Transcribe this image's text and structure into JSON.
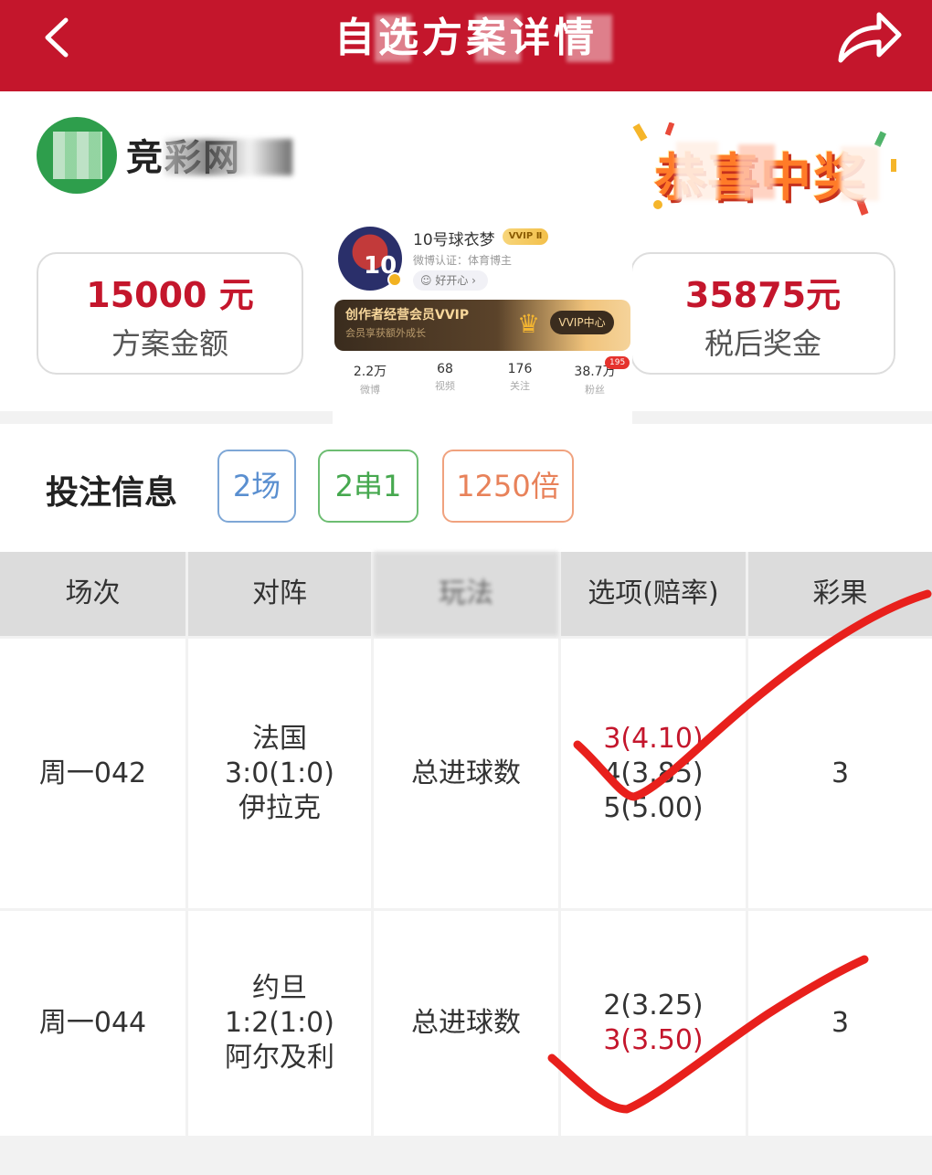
{
  "header": {
    "title": "自选方案详情",
    "back_icon": "chevron-left-icon",
    "share_icon": "share-icon",
    "bg_color": "#c4162c"
  },
  "brand": {
    "logo_icon": "lottery-logo-icon",
    "name": "竞彩网",
    "badge": "恭喜中奖"
  },
  "summary": {
    "plan_amount": "15000 元",
    "plan_amount_label": "方案金额",
    "prize_amount": "35875元",
    "prize_amount_label": "税后奖金"
  },
  "profile": {
    "name": "10号球衣梦",
    "vip_tag": "VVIP Ⅱ",
    "certification": "微博认证：体育博主",
    "mood": "☺ 好开心 ›",
    "vip_banner_title": "创作者经营会员VVIP",
    "vip_banner_sub": "会员享获额外成长",
    "vip_center": "VVIP中心",
    "avatar_number": "10",
    "stats": [
      {
        "num": "2.2万",
        "label": "微博"
      },
      {
        "num": "68",
        "label": "视频"
      },
      {
        "num": "176",
        "label": "关注"
      },
      {
        "num": "38.7万",
        "label": "粉丝"
      }
    ],
    "fans_badge": "195"
  },
  "bet_info": {
    "title": "投注信息",
    "tags": [
      "2场",
      "2串1",
      "1250倍"
    ]
  },
  "table": {
    "headers": [
      "场次",
      "对阵",
      "玩法",
      "选项(赔率)",
      "彩果"
    ],
    "rows": [
      {
        "match_no": "周一042",
        "home": "法国",
        "score": "3:0(1:0)",
        "away": "伊拉克",
        "play": "总进球数",
        "options": [
          {
            "text": "3(4.10)",
            "hit": true
          },
          {
            "text": "4(3.85)",
            "hit": false
          },
          {
            "text": "5(5.00)",
            "hit": false
          }
        ],
        "result": "3"
      },
      {
        "match_no": "周一044",
        "home": "约旦",
        "score": "1:2(1:0)",
        "away": "阿尔及利",
        "play": "总进球数",
        "options": [
          {
            "text": "2(3.25)",
            "hit": false
          },
          {
            "text": "3(3.50)",
            "hit": true
          }
        ],
        "result": "3"
      }
    ]
  },
  "colors": {
    "accent_red": "#c4162c",
    "check_mark": "#e8201c"
  }
}
